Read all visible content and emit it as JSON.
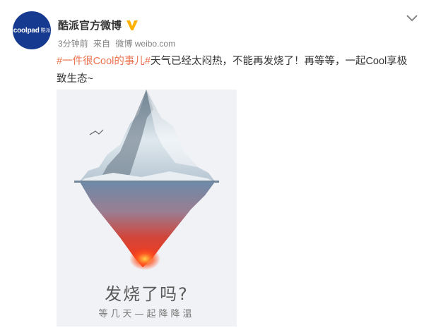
{
  "post": {
    "avatar_brand": "coolpad",
    "avatar_sub": "酷派",
    "username": "酷派官方微博",
    "time": "3分钟前",
    "source_prefix": "来自",
    "source": "微博 weibo.com",
    "hashtag": "#一件很Cool的事儿#",
    "text": "天气已经太闷热，不能再发烧了！再等等，一起Cool享极致生态~"
  },
  "poster": {
    "title": "发烧了吗?",
    "subtitle": "等几天—起降降温"
  },
  "icons": {
    "verified": "verified-v-icon",
    "expand": "chevron-down-icon"
  },
  "colors": {
    "hashtag": "#eb7350",
    "verified": "#ffb300",
    "avatar_bg": "#163a8f"
  }
}
